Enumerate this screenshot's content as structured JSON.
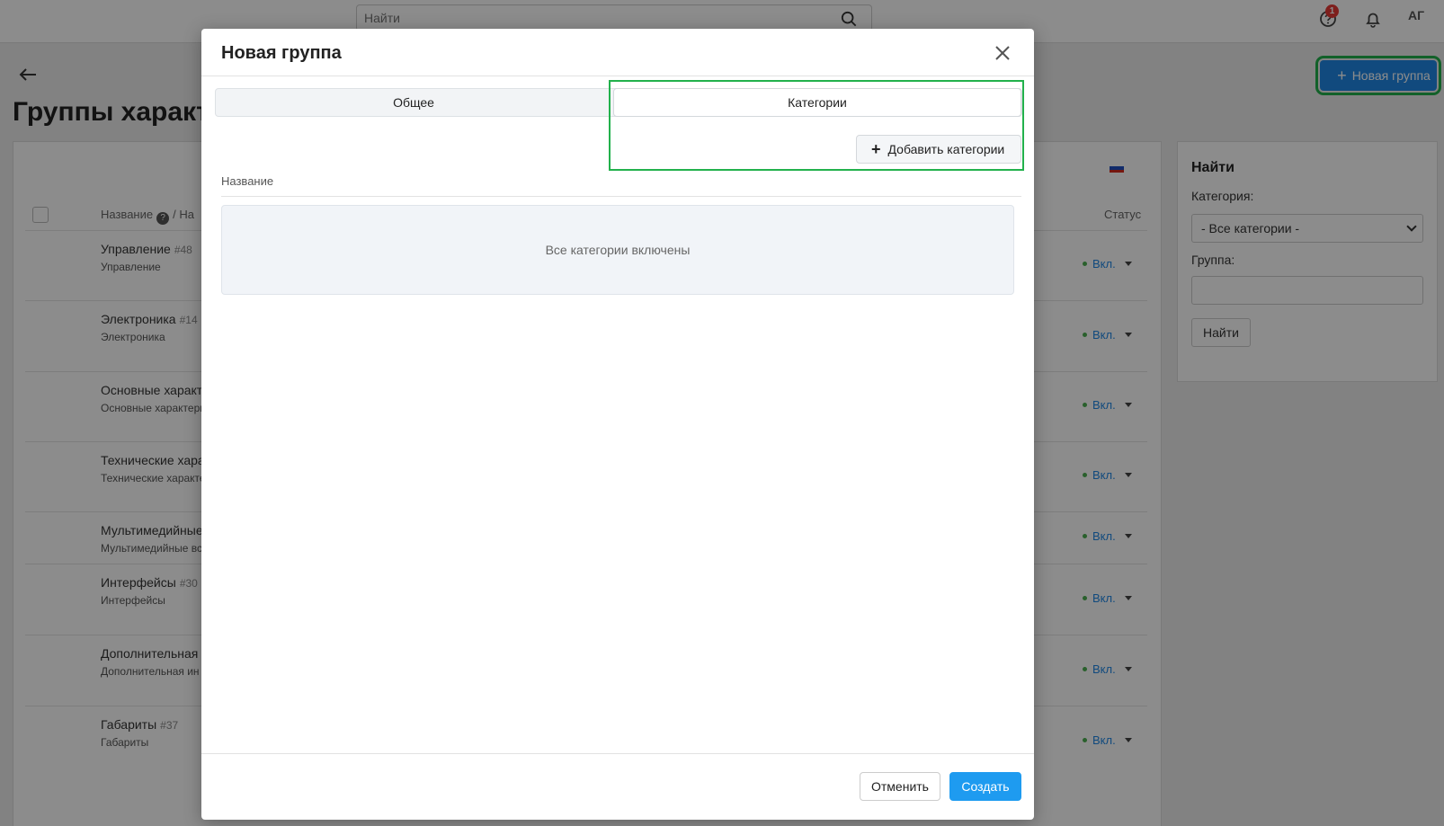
{
  "topbar": {
    "search_placeholder": "Найти",
    "notifications_badge": "1",
    "avatar_initials": "АГ"
  },
  "page": {
    "title": "Группы характ",
    "new_group_label": "Новая группа"
  },
  "list": {
    "col_name": "Название",
    "col_name_suffix": "/ На",
    "col_status": "Статус",
    "rows": [
      {
        "title": "Управление",
        "id": "#48",
        "sub": "Управление",
        "status": "Вкл."
      },
      {
        "title": "Электроника",
        "id": "#14",
        "sub": "Электроника",
        "status": "Вкл."
      },
      {
        "title": "Основные характ",
        "id": "",
        "sub": "Основные характери",
        "status": "Вкл."
      },
      {
        "title": "Технические хара",
        "id": "",
        "sub": "Технические характе",
        "status": "Вкл."
      },
      {
        "title": "Мультимедийные",
        "id": "",
        "sub": "Мультимедийные вс",
        "status": "Вкл."
      },
      {
        "title": "Интерфейсы",
        "id": "#30",
        "sub": "Интерфейсы",
        "status": "Вкл."
      },
      {
        "title": "Дополнительная",
        "id": "",
        "sub": "Дополнительная ин",
        "status": "Вкл."
      },
      {
        "title": "Габариты",
        "id": "#37",
        "sub": "Габариты",
        "status": "Вкл."
      }
    ]
  },
  "filter": {
    "title": "Найти",
    "category_label": "Категория:",
    "category_value": "- Все категории -",
    "group_label": "Группа:",
    "button": "Найти"
  },
  "modal": {
    "title": "Новая группа",
    "tabs": [
      {
        "label": "Общее"
      },
      {
        "label": "Категории"
      }
    ],
    "add_categories_label": "Добавить категории",
    "column_label": "Название",
    "empty_text": "Все категории включены",
    "cancel_label": "Отменить",
    "create_label": "Создать"
  },
  "colors": {
    "primary": "#1e9bf0",
    "highlight": "#22b14c",
    "status_dot": "#4caf50",
    "badge": "#e53935"
  },
  "icons": [
    "search-icon",
    "help-icon",
    "bell-icon",
    "back-arrow-icon",
    "plus-icon",
    "close-icon",
    "ru-flag-icon",
    "question-icon",
    "chevron-down-icon"
  ]
}
